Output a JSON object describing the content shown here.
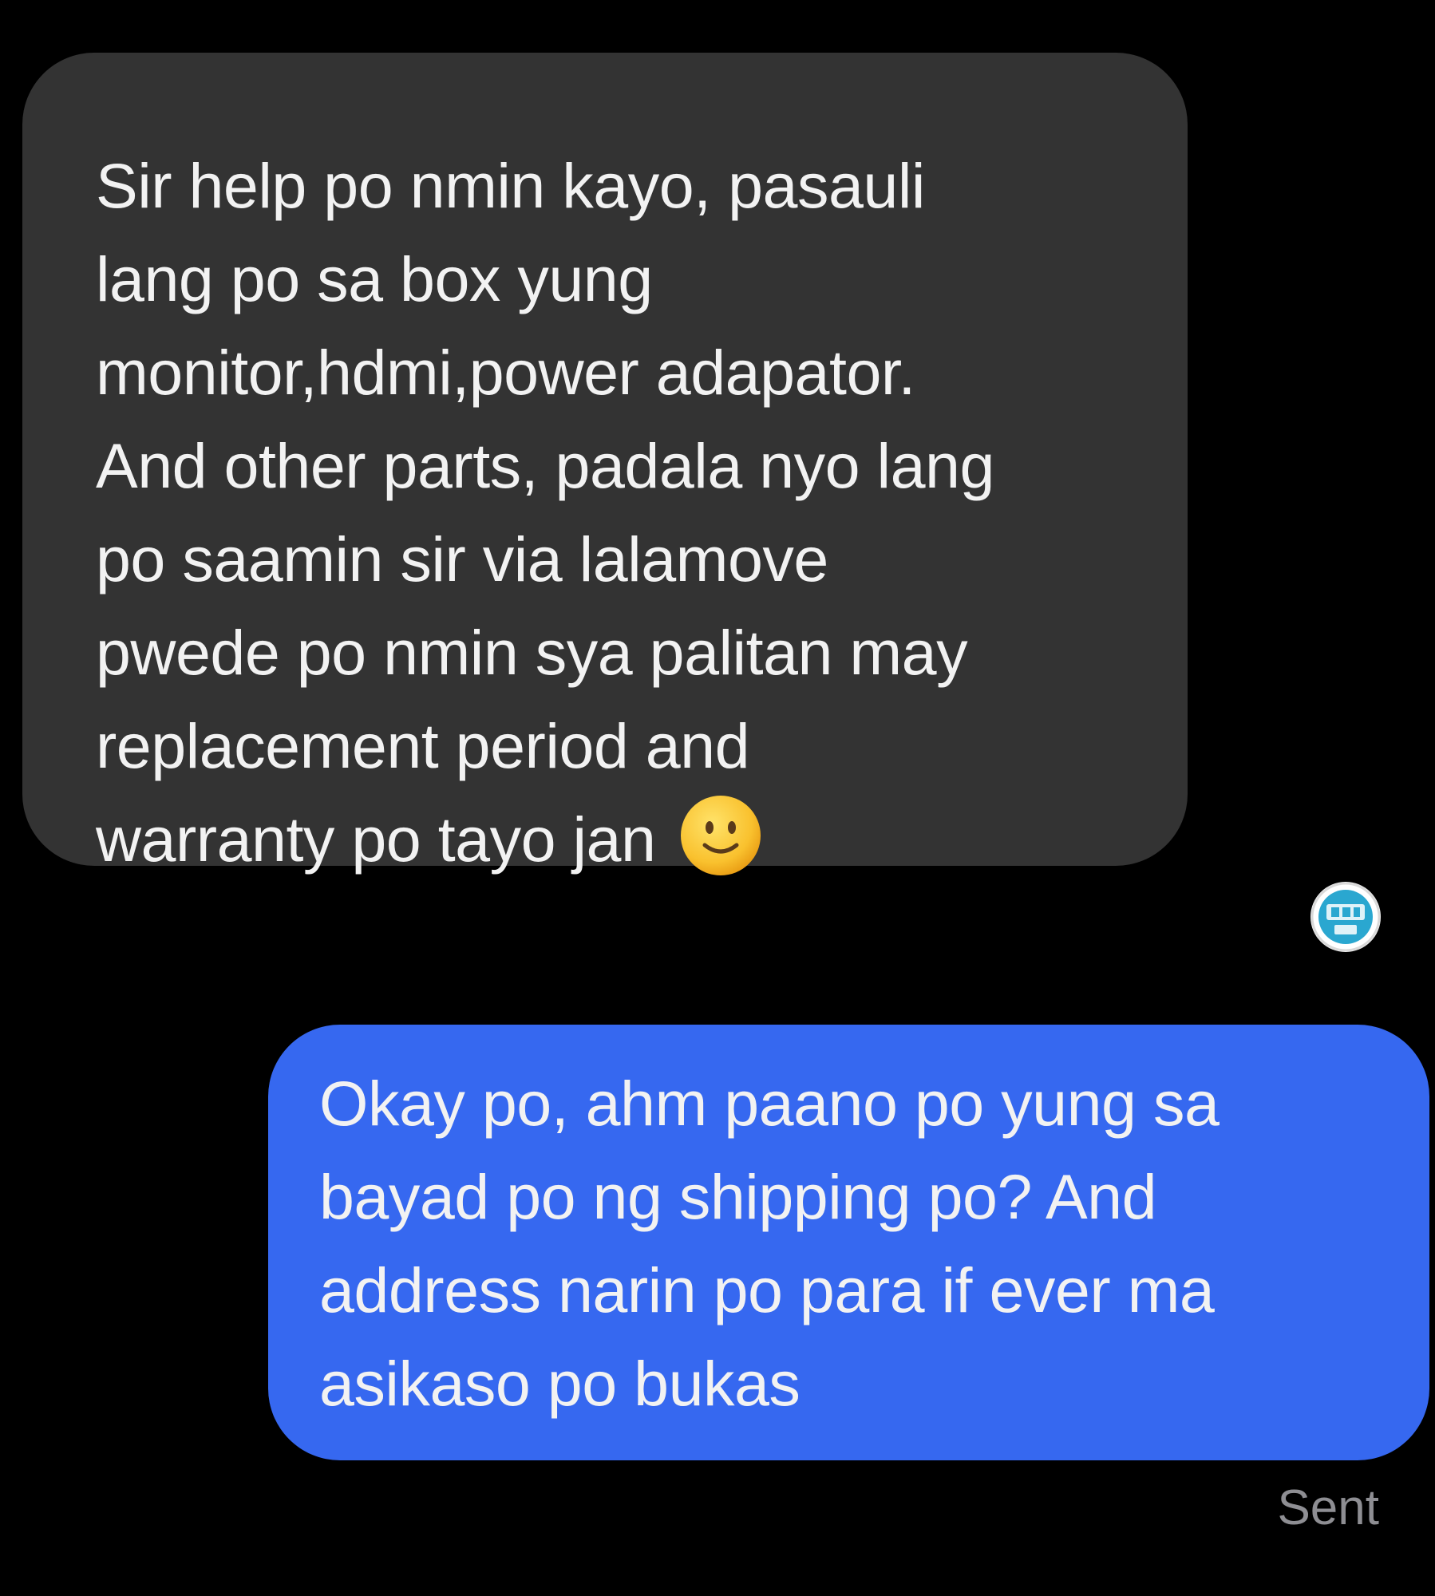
{
  "colors": {
    "background": "#000000",
    "received_bubble": "#333333",
    "sent_bubble": "#3668f0",
    "message_text": "#f2f2f2",
    "status_text": "#8e8e93",
    "avatar_accent": "#2aa7d0"
  },
  "conversation": {
    "messages": [
      {
        "direction": "received",
        "lines": [
          "Sir help po nmin kayo, pasauli",
          "lang po sa box yung",
          "monitor,hdmi,power adapator.",
          "And other parts, padala nyo lang",
          "po saamin sir via lalamove",
          "pwede po nmin sya palitan may",
          "replacement period and",
          "warranty po tayo jan"
        ],
        "emoji": "slightly-smiling-face-icon"
      },
      {
        "direction": "sent",
        "lines": [
          "Okay po, ahm paano po yung sa",
          "bayad po ng shipping po? And",
          "address narin po para if ever ma",
          "asikaso po bukas"
        ],
        "status": "Sent"
      }
    ],
    "read_receipt_avatar": "seen-avatar-icon"
  }
}
